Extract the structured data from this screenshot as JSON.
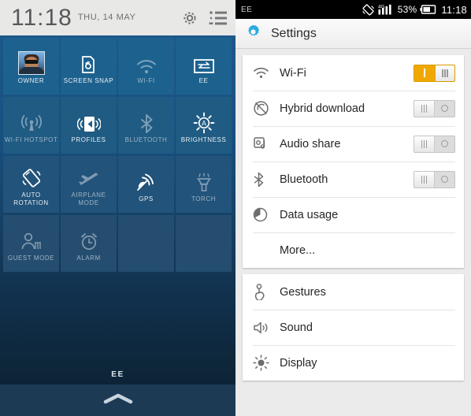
{
  "quick_settings": {
    "clock": "11:18",
    "date": "THU, 14 MAY",
    "gear_icon": "gear-icon",
    "list_icon": "list-view-icon",
    "carrier": "EE",
    "handle_icon": "collapse-chevron-icon",
    "tiles": [
      {
        "label": "OWNER",
        "icon": "user-avatar",
        "state": "active"
      },
      {
        "label": "SCREEN SNAP",
        "icon": "screen-snap-icon",
        "state": "active"
      },
      {
        "label": "WI-FI",
        "icon": "wifi-icon",
        "state": "inactive"
      },
      {
        "label": "EE",
        "icon": "data-transfer-icon",
        "state": "active"
      },
      {
        "label": "WI-FI HOTSPOT",
        "icon": "hotspot-icon",
        "state": "inactive"
      },
      {
        "label": "PROFILES",
        "icon": "profiles-icon",
        "state": "active"
      },
      {
        "label": "BLUETOOTH",
        "icon": "bluetooth-icon",
        "state": "inactive"
      },
      {
        "label": "BRIGHTNESS",
        "icon": "brightness-auto-icon",
        "state": "active"
      },
      {
        "label": "AUTO ROTATION",
        "icon": "auto-rotation-icon",
        "state": "active"
      },
      {
        "label": "AIRPLANE MODE",
        "icon": "airplane-icon",
        "state": "inactive"
      },
      {
        "label": "GPS",
        "icon": "gps-icon",
        "state": "active"
      },
      {
        "label": "TORCH",
        "icon": "torch-icon",
        "state": "inactive"
      },
      {
        "label": "GUEST MODE",
        "icon": "guest-mode-icon",
        "state": "inactive"
      },
      {
        "label": "ALARM",
        "icon": "alarm-clock-icon",
        "state": "inactive"
      }
    ]
  },
  "settings": {
    "statusbar": {
      "carrier": "EE",
      "rotation_icon": "auto-rotate-icon",
      "network_type": "4G",
      "signal_icon": "signal-bars-icon",
      "battery_percent": "53%",
      "battery_icon": "battery-icon",
      "clock": "11:18"
    },
    "appbar": {
      "title": "Settings",
      "icon": "settings-gear-icon"
    },
    "groups": [
      {
        "rows": [
          {
            "label": "Wi-Fi",
            "icon": "wifi-icon",
            "toggle": "on"
          },
          {
            "label": "Hybrid download",
            "icon": "hybrid-download-icon",
            "toggle": "off"
          },
          {
            "label": "Audio share",
            "icon": "audio-share-icon",
            "toggle": "off"
          },
          {
            "label": "Bluetooth",
            "icon": "bluetooth-icon",
            "toggle": "off"
          },
          {
            "label": "Data usage",
            "icon": "data-usage-icon",
            "toggle": "none"
          },
          {
            "label": "More...",
            "icon": "none",
            "toggle": "none"
          }
        ]
      },
      {
        "rows": [
          {
            "label": "Gestures",
            "icon": "gestures-icon",
            "toggle": "none"
          },
          {
            "label": "Sound",
            "icon": "sound-icon",
            "toggle": "none"
          },
          {
            "label": "Display",
            "icon": "display-icon",
            "toggle": "none"
          }
        ]
      }
    ]
  },
  "colors": {
    "tile_blue": "#1d628f",
    "toggle_on": "#f0a800",
    "accent_cyan": "#29abe2"
  }
}
